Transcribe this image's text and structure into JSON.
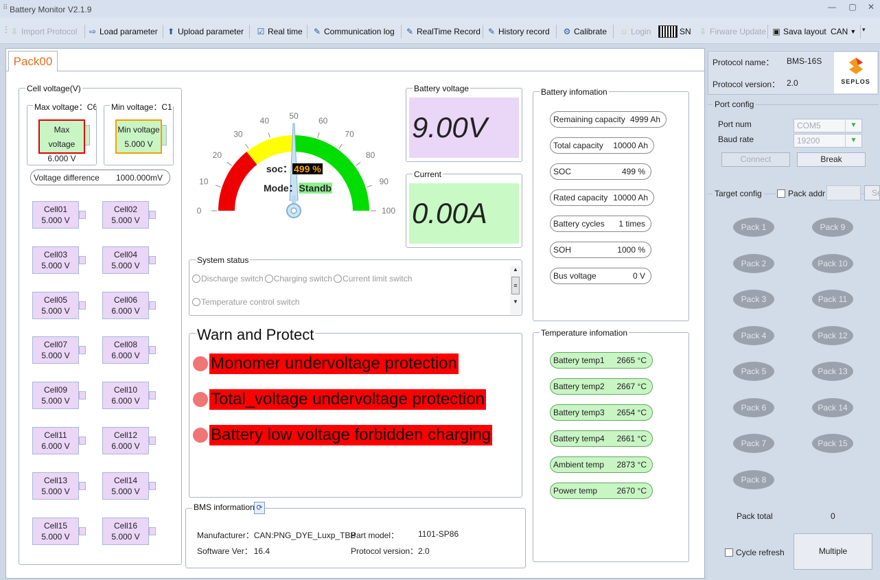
{
  "window": {
    "title": "Battery Monitor V2.1.9"
  },
  "toolbar": {
    "import": "Import Protocol",
    "load": "Load parameter",
    "upload": "Upload parameter",
    "realtime": "Real time",
    "commlog": "Communication log",
    "rtrecord": "RealTime Record",
    "history": "History record",
    "calibrate": "Calibrate",
    "login": "Login",
    "sn": "SN",
    "firmware": "Firware Update",
    "savelayout": "Sava layout",
    "can": "CAN"
  },
  "tab": "Pack00",
  "cellvoltage": {
    "label": "Cell voltage(V)",
    "max_label": "Max voltage：C6",
    "min_label": "Min voltage：C1",
    "max_inner": "Max voltage",
    "max_value": "6.000 V",
    "min_inner": "Min voltage",
    "min_value": "5.000 V",
    "diff_label": "Voltage difference",
    "diff_value": "1000.000mV"
  },
  "cells": [
    [
      "Cell01",
      "5.000 V"
    ],
    [
      "Cell02",
      "5.000 V"
    ],
    [
      "Cell03",
      "5.000 V"
    ],
    [
      "Cell04",
      "5.000 V"
    ],
    [
      "Cell05",
      "5.000 V"
    ],
    [
      "Cell06",
      "6.000 V"
    ],
    [
      "Cell07",
      "5.000 V"
    ],
    [
      "Cell08",
      "6.000 V"
    ],
    [
      "Cell09",
      "5.000 V"
    ],
    [
      "Cell10",
      "6.000 V"
    ],
    [
      "Cell11",
      "6.000 V"
    ],
    [
      "Cell12",
      "6.000 V"
    ],
    [
      "Cell13",
      "5.000 V"
    ],
    [
      "Cell14",
      "5.000 V"
    ],
    [
      "Cell15",
      "5.000 V"
    ],
    [
      "Cell16",
      "5.000 V"
    ]
  ],
  "gauge": {
    "ticks": [
      "0",
      "10",
      "20",
      "30",
      "40",
      "50",
      "60",
      "70",
      "80",
      "90",
      "100"
    ],
    "soc_label": "soc：",
    "soc_value": "499 %",
    "mode_label": "Mode：",
    "mode_value": "Standb"
  },
  "battery_voltage": {
    "label": "Battery voltage",
    "value": "9.00V"
  },
  "current": {
    "label": "Current",
    "value": "0.00A"
  },
  "system_status": {
    "label": "System status",
    "items": [
      "Discharge switch",
      "Charging switch",
      "Current limit switch",
      "Temperature control switch"
    ]
  },
  "warn": {
    "title": "Warn and Protect",
    "items": [
      "Monomer undervoltage protection",
      "Total_voltage undervoltage protection",
      "Battery low voltage forbidden charging"
    ]
  },
  "bms": {
    "label": "BMS information",
    "manufacturer_label": "Manufacturer：",
    "manufacturer": "CAN:PNG_DYE_Luxp_TBB",
    "part_label": "Part model：",
    "part": "1101-SP86",
    "software_label": "Software Ver：",
    "software": "16.4",
    "protocol_label": "Protocol version：",
    "protocol": "2.0"
  },
  "battery_info": {
    "label": "Battery infomation",
    "items": [
      [
        "Remaining capacity",
        "4999 Ah"
      ],
      [
        "Total capacity",
        "10000 Ah"
      ],
      [
        "SOC",
        "499 %"
      ],
      [
        "Rated capacity",
        "10000 Ah"
      ],
      [
        "Battery cycles",
        "1 times"
      ],
      [
        "SOH",
        "1000 %"
      ],
      [
        "Bus voltage",
        "0 V"
      ]
    ]
  },
  "temp_info": {
    "label": "Temperature infomation",
    "items": [
      [
        "Battery temp1",
        "2665 °C"
      ],
      [
        "Battery temp2",
        "2667 °C"
      ],
      [
        "Battery temp3",
        "2654 °C"
      ],
      [
        "Battery temp4",
        "2661 °C"
      ],
      [
        "Ambient temp",
        "2873 °C"
      ],
      [
        "Power temp",
        "2670 °C"
      ]
    ]
  },
  "right": {
    "protocol_name_label": "Protocol name：",
    "protocol_name": "BMS-16S",
    "protocol_version_label": "Protocol version：",
    "protocol_version": "2.0",
    "logo": "SEPLOS",
    "port_config": "Port config",
    "port_num": "Port num",
    "port_value": "COM5",
    "baud": "Baud rate",
    "baud_value": "19200",
    "connect": "Connect",
    "break": "Break",
    "target_config": "Target config",
    "pack_addr": "Pack addr",
    "se": "Se",
    "packs": [
      "Pack 1",
      "Pack 9",
      "Pack 2",
      "Pack 10",
      "Pack 3",
      "Pack 11",
      "Pack 4",
      "Pack 12",
      "Pack 5",
      "Pack 13",
      "Pack 6",
      "Pack 14",
      "Pack 7",
      "Pack 15",
      "Pack 8"
    ],
    "pack_total_label": "Pack total",
    "pack_total": "0",
    "cycle_refresh": "Cycle refresh",
    "multiple": "Multiple"
  },
  "colors": {
    "accent": "#e07020",
    "warn_red": "#ff0000",
    "gauge_red": "#ee0000",
    "gauge_yellow": "#ffff00",
    "gauge_green": "#00dd00"
  }
}
